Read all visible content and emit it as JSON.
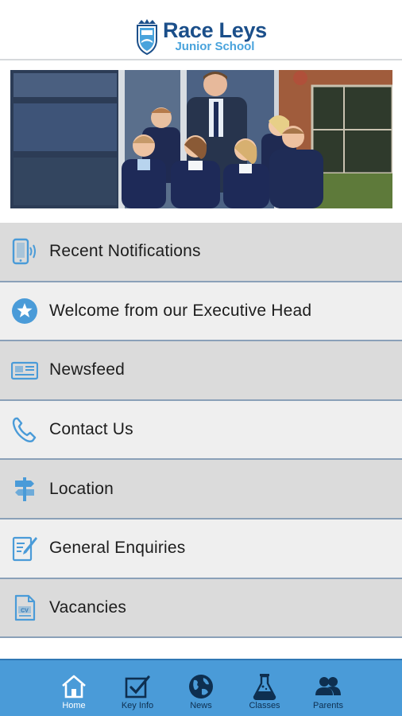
{
  "header": {
    "title": "Race Leys",
    "subtitle": "Junior School",
    "crest_icon": "school-crest-icon"
  },
  "colors": {
    "brand_dark": "#1b4f8a",
    "brand_light": "#49a3dc",
    "icon_blue": "#4a9bd8",
    "tabbar_bg": "#4a9bd8",
    "menu_dark": "#dbdbdb",
    "menu_light": "#efefef"
  },
  "menu": {
    "items": [
      {
        "label": "Recent Notifications",
        "icon": "phone-vibrate-icon"
      },
      {
        "label": "Welcome from our Executive Head",
        "icon": "star-circle-icon"
      },
      {
        "label": "Newsfeed",
        "icon": "newspaper-icon"
      },
      {
        "label": "Contact Us",
        "icon": "telephone-icon"
      },
      {
        "label": "Location",
        "icon": "signpost-icon"
      },
      {
        "label": "General Enquiries",
        "icon": "edit-document-icon"
      },
      {
        "label": "Vacancies",
        "icon": "cv-document-icon"
      }
    ]
  },
  "tabs": [
    {
      "label": "Home",
      "icon": "home-icon",
      "active": true
    },
    {
      "label": "Key Info",
      "icon": "checkbox-icon",
      "active": false
    },
    {
      "label": "News",
      "icon": "globe-icon",
      "active": false
    },
    {
      "label": "Classes",
      "icon": "flask-icon",
      "active": false
    },
    {
      "label": "Parents",
      "icon": "parents-icon",
      "active": false
    }
  ]
}
